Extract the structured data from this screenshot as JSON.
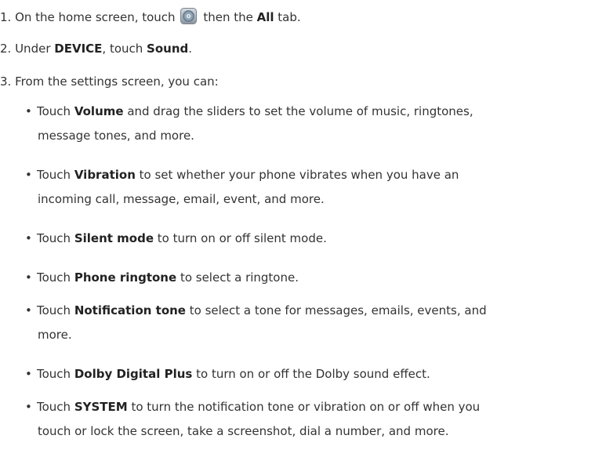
{
  "steps": [
    {
      "prefix": "1. On the home screen, touch",
      "icon": "settings-icon",
      "middle": " then the ",
      "bold": "All",
      "suffix": " tab."
    },
    {
      "prefix": "2. Under ",
      "bold1": "DEVICE",
      "middle": ", touch ",
      "bold2": "Sound",
      "suffix": "."
    },
    {
      "text": "3. From the settings screen, you can:"
    }
  ],
  "bullets": [
    {
      "lead": "Touch ",
      "bold": "Volume",
      "line1": " and drag the sliders to set the volume of music, ringtones,",
      "line2": "message tones, and more."
    },
    {
      "lead": "Touch ",
      "bold": "Vibration",
      "line1": " to set whether your phone vibrates when you have an",
      "line2": "incoming call, message, email, event, and more."
    },
    {
      "lead": "Touch ",
      "bold": "Silent mode",
      "line1": " to turn on or off silent mode."
    },
    {
      "lead": "Touch ",
      "bold": "Phone ringtone",
      "line1": " to select a ringtone."
    },
    {
      "lead": "Touch ",
      "bold": "Notification tone",
      "line1": " to select a tone for messages, emails, events, and",
      "line2": "more."
    },
    {
      "lead": "Touch ",
      "bold": "Dolby Digital Plus",
      "line1": " to turn on or off the Dolby sound effect."
    },
    {
      "lead": "Touch ",
      "bold": "SYSTEM",
      "line1": " to turn the notification tone or vibration on or off when you",
      "line2": "touch or lock the screen, take a screenshot, dial a number, and more."
    }
  ],
  "bullet_char": "•"
}
